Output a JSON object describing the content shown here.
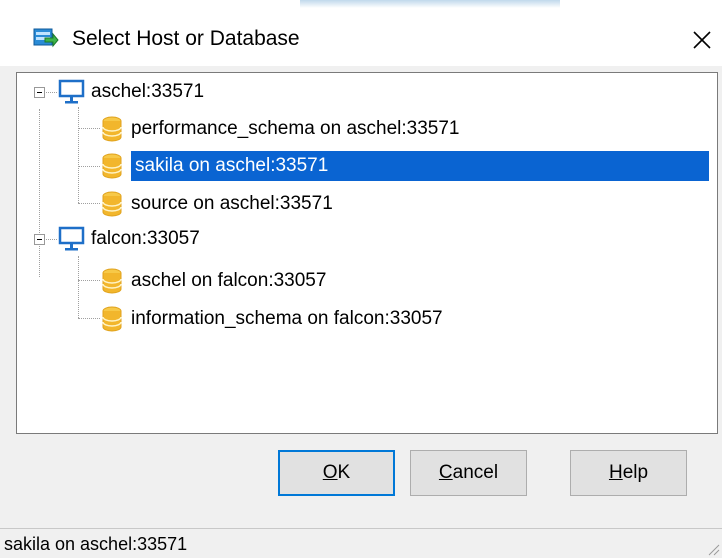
{
  "window": {
    "title": "Select Host or Database",
    "icon": "database-select-icon",
    "close_icon": "close-icon"
  },
  "tree": {
    "hosts": [
      {
        "label": "aschel:33571",
        "icon": "monitor-icon",
        "expanded": true,
        "children": [
          {
            "label": "performance_schema on aschel:33571",
            "icon": "database-icon"
          },
          {
            "label": "sakila on aschel:33571",
            "icon": "database-icon",
            "selected": true
          },
          {
            "label": "source on aschel:33571",
            "icon": "database-icon"
          }
        ]
      },
      {
        "label": "falcon:33057",
        "icon": "monitor-icon",
        "expanded": true,
        "children": [
          {
            "label": "aschel on falcon:33057",
            "icon": "database-icon"
          },
          {
            "label": "information_schema on falcon:33057",
            "icon": "database-icon"
          }
        ]
      }
    ]
  },
  "buttons": {
    "ok": {
      "mnemonic": "O",
      "rest": "K"
    },
    "cancel": {
      "mnemonic": "C",
      "rest": "ancel"
    },
    "help": {
      "mnemonic": "H",
      "rest": "elp"
    }
  },
  "status": {
    "text": "sakila on aschel:33571"
  },
  "colors": {
    "selection": "#0a64d2",
    "default_button_border": "#0078d7",
    "dialog_bg": "#f0f0f0",
    "database_icon": "#f2b62c",
    "monitor_icon": "#1e6fc8"
  }
}
